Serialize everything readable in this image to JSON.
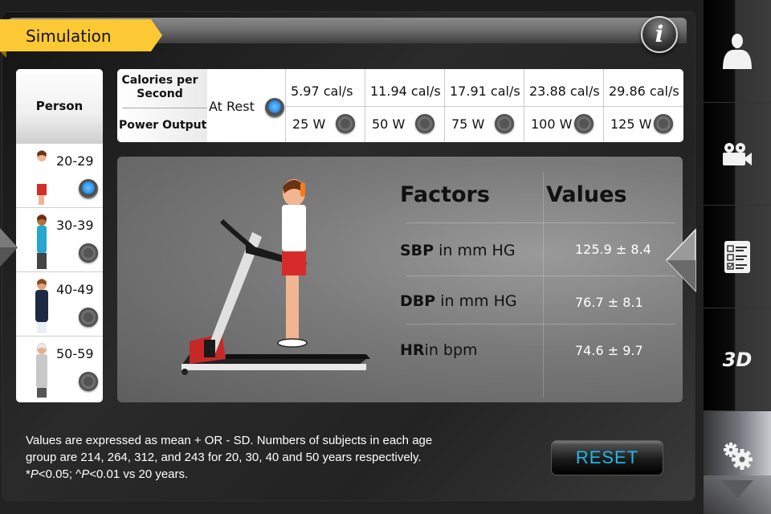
{
  "header": {
    "title": "Simulation",
    "info_icon": "info-icon"
  },
  "person": {
    "header": "Person",
    "rows": [
      {
        "age": "20-29",
        "selected": true,
        "shirt_color": "#ffffff",
        "pants_color": "#d62b2b",
        "hair_color": "#6b3415"
      },
      {
        "age": "30-39",
        "selected": false,
        "shirt_color": "#27a6cf",
        "pants_color": "#444444",
        "hair_color": "#6b2f14"
      },
      {
        "age": "40-49",
        "selected": false,
        "shirt_color": "#1d2a44",
        "pants_color": "#e8eef5",
        "hair_color": "#8a4a1e"
      },
      {
        "age": "50-59",
        "selected": false,
        "shirt_color": "#c8c8c8",
        "pants_color": "#555555",
        "hair_color": "#e8e8e8"
      }
    ]
  },
  "power_table": {
    "calories_label": "Calories per Second",
    "power_label": "Power Output",
    "rest_label": "At Rest",
    "rest_selected": true,
    "columns": [
      {
        "calories": "5.97 cal/s",
        "power": "25 W",
        "selected": false
      },
      {
        "calories": "11.94 cal/s",
        "power": "50 W",
        "selected": false
      },
      {
        "calories": "17.91 cal/s",
        "power": "75 W",
        "selected": false
      },
      {
        "calories": "23.88 cal/s",
        "power": "100 W",
        "selected": false
      },
      {
        "calories": "29.86 cal/s",
        "power": "125 W",
        "selected": false
      }
    ]
  },
  "factors": {
    "header_factor": "Factors",
    "header_value": "Values",
    "rows": [
      {
        "abbr": "SBP",
        "unit": " in mm HG",
        "value": "125.9 ± 8.4"
      },
      {
        "abbr": "DBP",
        "unit": " in mm HG",
        "value": "76.7 ± 8.1"
      },
      {
        "abbr": "HR",
        "unit": "in bpm",
        "value": "74.6 ± 9.7"
      }
    ]
  },
  "footnote": {
    "line1": "Values are expressed as mean + OR - SD. Numbers of subjects in each age",
    "line2": "group are 214, 264, 312, and 243 for 20, 30, 40 and 50 years respectively.",
    "p1_prefix": "*",
    "p1_italic": "P",
    "p1_rest": "<0.05; ^",
    "p2_italic": "P",
    "p2_rest": "<0.01 vs 20 years."
  },
  "reset_label": "RESET",
  "sidebar": {
    "items": [
      {
        "name": "anatomy",
        "icon": "person-bust-icon"
      },
      {
        "name": "video",
        "icon": "video-camera-icon"
      },
      {
        "name": "checklist",
        "icon": "checklist-icon"
      },
      {
        "name": "3d",
        "label": "3D"
      },
      {
        "name": "settings",
        "icon": "gears-icon",
        "active": true
      }
    ]
  },
  "colors": {
    "ribbon": "#fcc833",
    "radio_selected": "#2b8fe8",
    "reset_text": "#22b7e6"
  }
}
